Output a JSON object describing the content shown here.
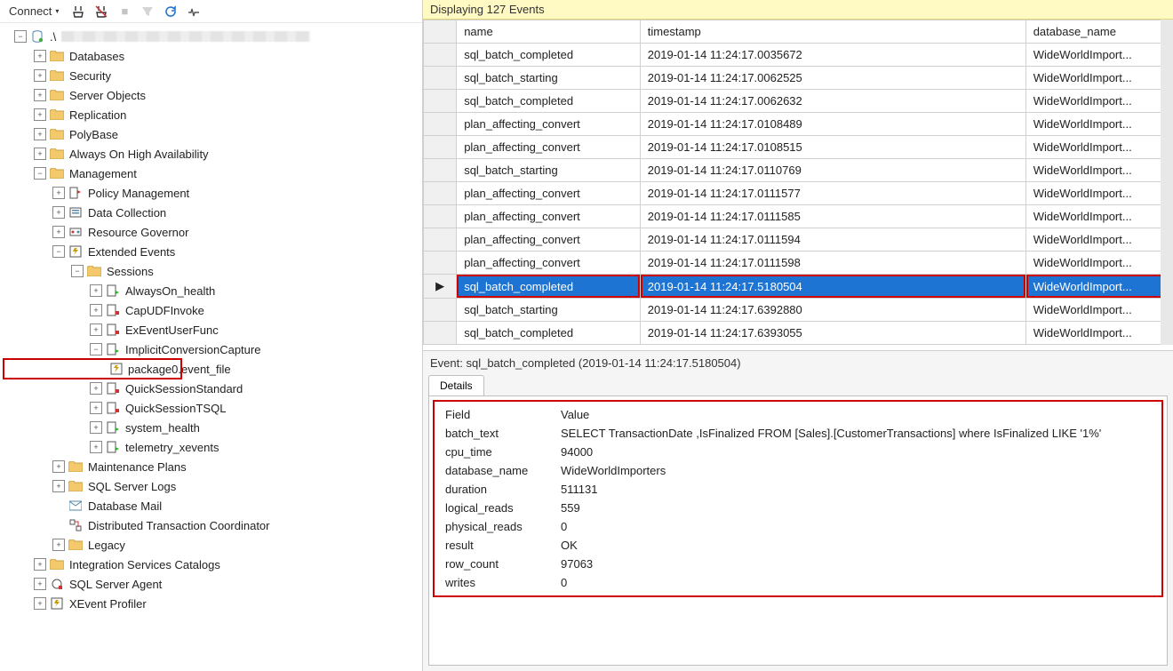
{
  "toolbar": {
    "connect_label": "Connect"
  },
  "tree": {
    "server_label": ".\\",
    "databases": "Databases",
    "security": "Security",
    "server_objects": "Server Objects",
    "replication": "Replication",
    "polybase": "PolyBase",
    "always_on": "Always On High Availability",
    "management": "Management",
    "policy_management": "Policy Management",
    "data_collection": "Data Collection",
    "resource_governor": "Resource Governor",
    "extended_events": "Extended Events",
    "sessions": "Sessions",
    "alwayson_health": "AlwaysOn_health",
    "capudfinvoke": "CapUDFInvoke",
    "exeventuserfunc": "ExEventUserFunc",
    "implicitconversion": "ImplicitConversionCapture",
    "package0_event_file": "package0.event_file",
    "quicksessionstandard": "QuickSessionStandard",
    "quicksessiontsql": "QuickSessionTSQL",
    "system_health": "system_health",
    "telemetry_xevents": "telemetry_xevents",
    "maintenance_plans": "Maintenance Plans",
    "sql_server_logs": "SQL Server Logs",
    "database_mail": "Database Mail",
    "dtc": "Distributed Transaction Coordinator",
    "legacy": "Legacy",
    "integration_services": "Integration Services Catalogs",
    "sql_server_agent": "SQL Server Agent",
    "xevent_profiler": "XEvent Profiler"
  },
  "events_header": "Displaying 127 Events",
  "grid": {
    "col_name": "name",
    "col_timestamp": "timestamp",
    "col_database_name": "database_name",
    "rows": [
      {
        "name": "sql_batch_completed",
        "timestamp": "2019-01-14 11:24:17.0035672",
        "database_name": "WideWorldImport..."
      },
      {
        "name": "sql_batch_starting",
        "timestamp": "2019-01-14 11:24:17.0062525",
        "database_name": "WideWorldImport..."
      },
      {
        "name": "sql_batch_completed",
        "timestamp": "2019-01-14 11:24:17.0062632",
        "database_name": "WideWorldImport..."
      },
      {
        "name": "plan_affecting_convert",
        "timestamp": "2019-01-14 11:24:17.0108489",
        "database_name": "WideWorldImport..."
      },
      {
        "name": "plan_affecting_convert",
        "timestamp": "2019-01-14 11:24:17.0108515",
        "database_name": "WideWorldImport..."
      },
      {
        "name": "sql_batch_starting",
        "timestamp": "2019-01-14 11:24:17.0110769",
        "database_name": "WideWorldImport..."
      },
      {
        "name": "plan_affecting_convert",
        "timestamp": "2019-01-14 11:24:17.0111577",
        "database_name": "WideWorldImport..."
      },
      {
        "name": "plan_affecting_convert",
        "timestamp": "2019-01-14 11:24:17.0111585",
        "database_name": "WideWorldImport..."
      },
      {
        "name": "plan_affecting_convert",
        "timestamp": "2019-01-14 11:24:17.0111594",
        "database_name": "WideWorldImport..."
      },
      {
        "name": "plan_affecting_convert",
        "timestamp": "2019-01-14 11:24:17.0111598",
        "database_name": "WideWorldImport..."
      },
      {
        "name": "sql_batch_completed",
        "timestamp": "2019-01-14 11:24:17.5180504",
        "database_name": "WideWorldImport...",
        "selected": true
      },
      {
        "name": "sql_batch_starting",
        "timestamp": "2019-01-14 11:24:17.6392880",
        "database_name": "WideWorldImport..."
      },
      {
        "name": "sql_batch_completed",
        "timestamp": "2019-01-14 11:24:17.6393055",
        "database_name": "WideWorldImport..."
      }
    ]
  },
  "details": {
    "event_line": "Event: sql_batch_completed (2019-01-14 11:24:17.5180504)",
    "tab_label": "Details",
    "headers": {
      "field": "Field",
      "value": "Value"
    },
    "fields": [
      {
        "k": "batch_text",
        "v": "SELECT TransactionDate      ,IsFinalized    FROM [Sales].[CustomerTransactions]  where IsFinalized  LIKE '1%'"
      },
      {
        "k": "cpu_time",
        "v": "94000"
      },
      {
        "k": "database_name",
        "v": "WideWorldImporters"
      },
      {
        "k": "duration",
        "v": "511131"
      },
      {
        "k": "logical_reads",
        "v": "559"
      },
      {
        "k": "physical_reads",
        "v": "0"
      },
      {
        "k": "result",
        "v": "OK"
      },
      {
        "k": "row_count",
        "v": "97063"
      },
      {
        "k": "writes",
        "v": "0"
      }
    ]
  }
}
